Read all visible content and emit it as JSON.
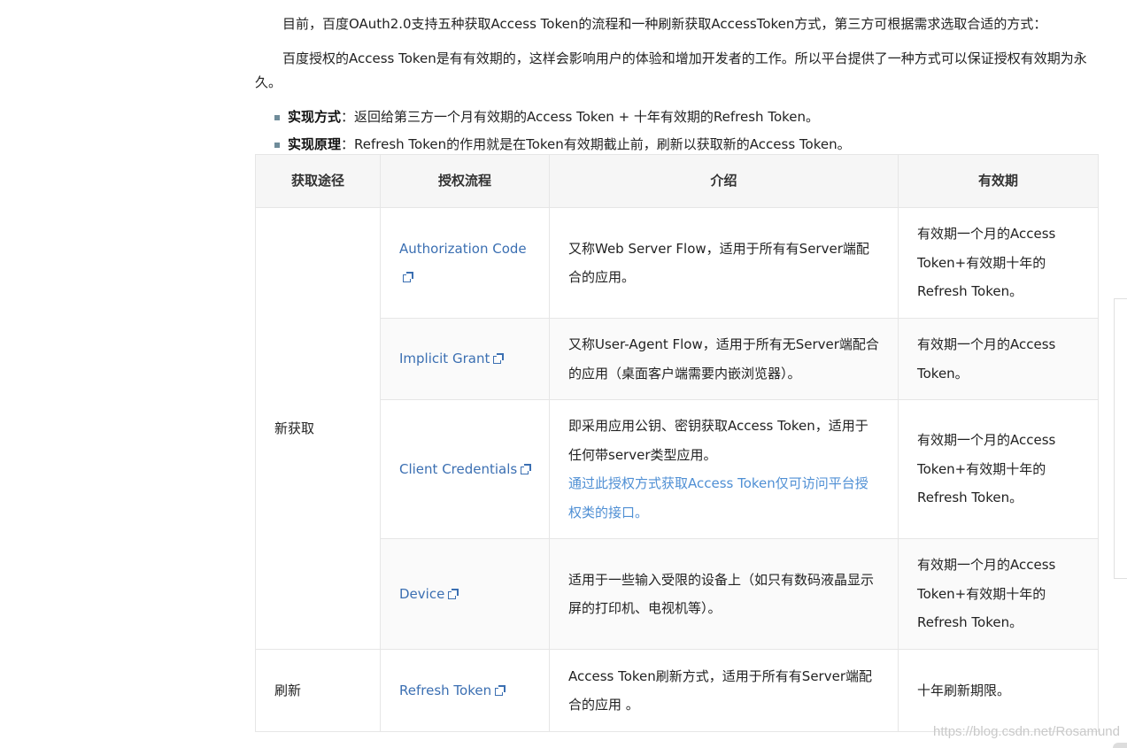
{
  "intro": {
    "p1": "目前，百度OAuth2.0支持五种获取Access Token的流程和一种刷新获取AccessToken方式，第三方可根据需求选取合适的方式：",
    "p2": "百度授权的Access Token是有有效期的，这样会影响用户的体验和增加开发者的工作。所以平台提供了一种方式可以保证授权有效期为永久。"
  },
  "bullets": [
    {
      "label": "实现方式",
      "text": "：返回给第三方一个月有效期的Access Token + 十年有效期的Refresh Token。"
    },
    {
      "label": "实现原理",
      "text": "：Refresh Token的作用就是在Token有效期截止前，刷新以获取新的Access Token。"
    }
  ],
  "table": {
    "headers": [
      "获取途径",
      "授权流程",
      "介绍",
      "有效期"
    ],
    "group_new": "新获取",
    "group_refresh": "刷新",
    "rows": [
      {
        "flow": "Authorization Code",
        "intro": "又称Web Server Flow，适用于所有有Server端配合的应用。",
        "note": "",
        "validity": "有效期一个月的Access Token+有效期十年的Refresh Token。"
      },
      {
        "flow": "Implicit Grant",
        "intro": "又称User-Agent Flow，适用于所有无Server端配合的应用（桌面客户端需要内嵌浏览器）。",
        "note": "",
        "validity": "有效期一个月的Access Token。"
      },
      {
        "flow": "Client Credentials",
        "intro": "即采用应用公钥、密钥获取Access Token，适用于任何带server类型应用。",
        "note": "通过此授权方式获取Access Token仅可访问平台授权类的接口。",
        "validity": "有效期一个月的Access Token+有效期十年的Refresh Token。"
      },
      {
        "flow": "Device",
        "intro": "适用于一些输入受限的设备上（如只有数码液晶显示屏的打印机、电视机等）。",
        "note": "",
        "validity": "有效期一个月的Access Token+有效期十年的Refresh Token。"
      },
      {
        "flow": "Refresh Token",
        "intro": "Access Token刷新方式，适用于所有有Server端配合的应用 。",
        "note": "",
        "validity": "十年刷新期限。"
      }
    ]
  },
  "watermark": "https://blog.csdn.net/Rosamund",
  "icons": {
    "external_link": "external-link-icon"
  },
  "colors": {
    "link": "#3b6fb2",
    "note": "#4f8fd4",
    "bullet": "#6f8c9a"
  }
}
